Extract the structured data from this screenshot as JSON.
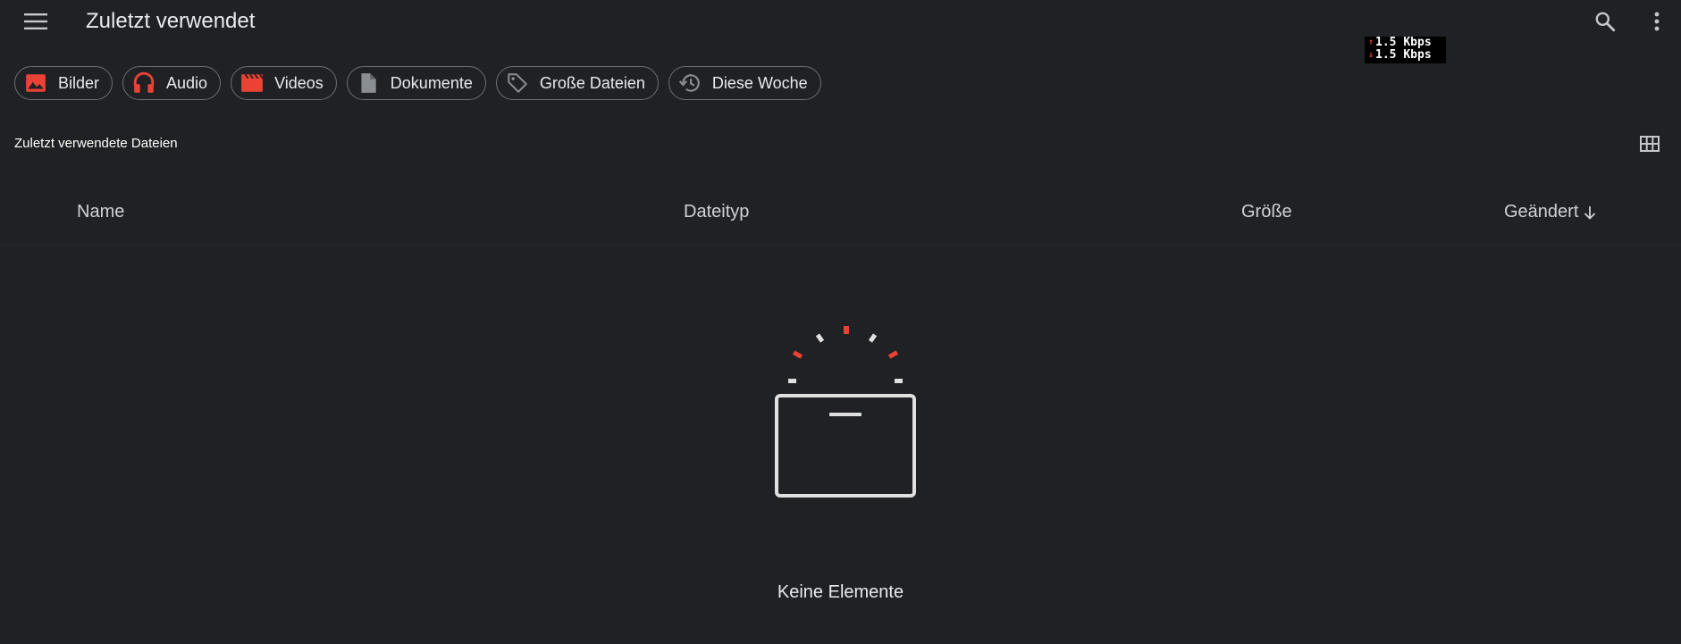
{
  "header": {
    "title": "Zuletzt verwendet",
    "menu_icon": "hamburger-menu-icon",
    "search_icon": "search-icon",
    "more_icon": "more-vert-icon"
  },
  "network_speed": {
    "upload": "1.5 Kbps",
    "download": "1.5 Kbps"
  },
  "chips": [
    {
      "label": "Bilder",
      "icon": "image-icon"
    },
    {
      "label": "Audio",
      "icon": "headphones-icon"
    },
    {
      "label": "Videos",
      "icon": "movie-icon"
    },
    {
      "label": "Dokumente",
      "icon": "document-icon"
    },
    {
      "label": "Große Dateien",
      "icon": "tag-icon"
    },
    {
      "label": "Diese Woche",
      "icon": "history-icon"
    }
  ],
  "section": {
    "title": "Zuletzt verwendete Dateien",
    "view_toggle_icon": "grid-view-icon"
  },
  "table": {
    "columns": [
      {
        "label": "Name"
      },
      {
        "label": "Dateityp"
      },
      {
        "label": "Größe"
      },
      {
        "label": "Geändert",
        "sort": "descending",
        "sort_icon": "arrow-down-icon"
      }
    ],
    "rows": []
  },
  "empty_state": {
    "message": "Keine Elemente",
    "icon": "empty-box-icon"
  },
  "colors": {
    "background": "#202124",
    "accent_red": "#ea4335",
    "text": "#e8eaed",
    "chip_border": "#6b6e73"
  }
}
